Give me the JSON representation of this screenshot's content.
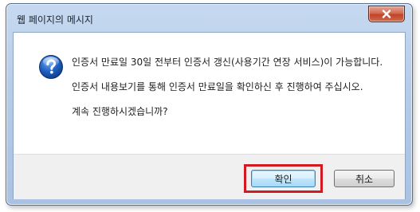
{
  "window": {
    "title": "웹 페이지의 메시지"
  },
  "icons": {
    "close": "close-icon",
    "message": "question-icon"
  },
  "message": {
    "line1": "인증서 만료일 30일 전부터 인증서 갱신(사용기간 연장 서비스)이 가능합니다.",
    "line2": "인증서 내용보기를 통해 인증서 만료일을 확인하신 후 진행하여 주십시오.",
    "line3": "계속 진행하시겠습니까?"
  },
  "buttons": {
    "ok_label": "확인",
    "cancel_label": "취소"
  },
  "colors": {
    "highlight": "#d11a22",
    "title_bar": "#b4cbe9",
    "close_button": "#c0432a"
  }
}
